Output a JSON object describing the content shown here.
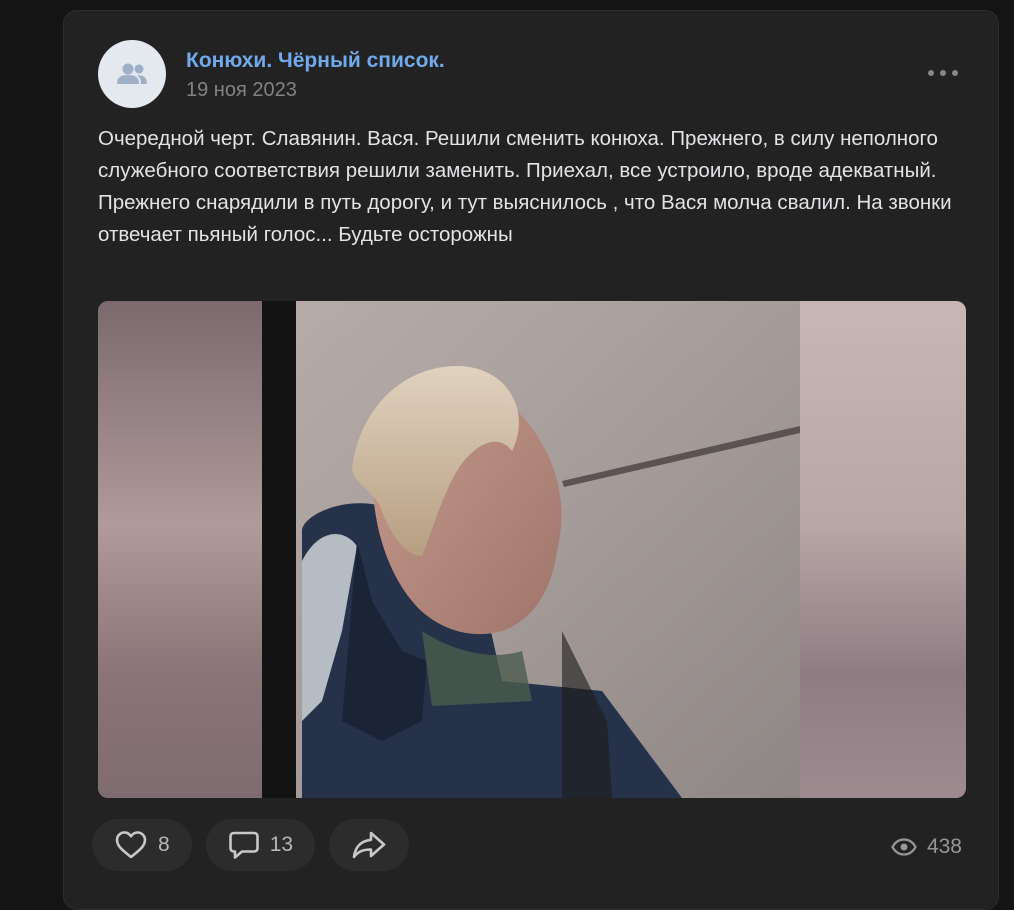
{
  "post": {
    "author": "Конюхи. Чёрный список.",
    "date": "19 ноя 2023",
    "text": "Очередной черт. Славянин. Вася. Решили сменить конюха. Прежнего, в силу неполного служебного соответствия решили заменить. Приехал, все устроило, вроде адекватный. Прежнего снарядили в путь дорогу, и тут выяснилось , что Вася молча свалил. На звонки отвечает пьяный голос... Будьте осторожны",
    "avatar_icon": "group-icon",
    "more_icon": "more-horizontal-icon"
  },
  "actions": {
    "likes": "8",
    "comments": "13",
    "views": "438",
    "like_icon": "heart-icon",
    "comment_icon": "comment-icon",
    "share_icon": "share-icon",
    "views_icon": "eye-icon"
  },
  "colors": {
    "accent": "#71aaeb",
    "background": "#141414",
    "card": "#222222"
  }
}
